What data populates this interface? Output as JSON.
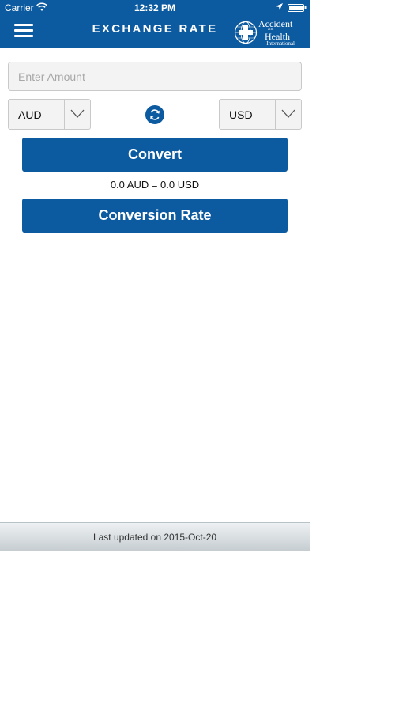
{
  "status_bar": {
    "carrier": "Carrier",
    "time": "12:32 PM",
    "icons": [
      "wifi-icon",
      "location-icon",
      "battery-icon"
    ]
  },
  "header": {
    "title": "EXCHANGE RATE",
    "menu_icon": "menu-icon",
    "logo": {
      "line1": "Accident",
      "and": "and",
      "line2": "Health",
      "line3": "International"
    }
  },
  "form": {
    "amount": {
      "placeholder": "Enter Amount",
      "value": ""
    },
    "from_currency": "AUD",
    "to_currency": "USD",
    "swap_icon": "swap-icon"
  },
  "actions": {
    "convert_label": "Convert",
    "rate_label": "Conversion Rate"
  },
  "result": {
    "text": "0.0 AUD = 0.0 USD"
  },
  "footer": {
    "text": "Last updated on 2015-Oct-20"
  },
  "colors": {
    "brand_blue": "#0c5aa0",
    "field_bg": "#f3f3f3",
    "field_border": "#c9c9c9"
  }
}
